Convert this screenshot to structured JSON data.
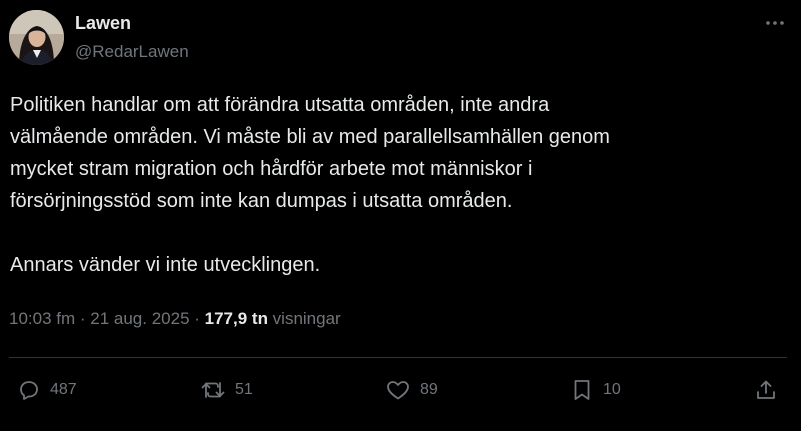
{
  "author": {
    "display_name": "Lawen",
    "handle": "@RedarLawen",
    "avatar_icon": "profile-photo"
  },
  "tweet": {
    "text": "Politiken handlar om att förändra utsatta områden, inte andra\nvälmående områden. Vi måste bli av med parallellsamhällen genom\nmycket stram migration och hårdför arbete mot människor i\nförsörjningsstöd som inte kan dumpas i utsatta områden.\n\nAnnars vänder vi inte utvecklingen."
  },
  "meta": {
    "time": "10:03 fm",
    "separator": " · ",
    "date": "21 aug. 2025",
    "views_count": "177,9 tn",
    "views_label": " visningar"
  },
  "actions": {
    "replies": "487",
    "reposts": "51",
    "likes": "89",
    "bookmarks": "10"
  },
  "icons": [
    "more-icon",
    "reply-icon",
    "repost-icon",
    "like-icon",
    "bookmark-icon",
    "share-icon"
  ],
  "colors": {
    "background": "#000000",
    "text": "#e7e9ea",
    "secondary": "#71767b",
    "divider": "#2f3336"
  }
}
